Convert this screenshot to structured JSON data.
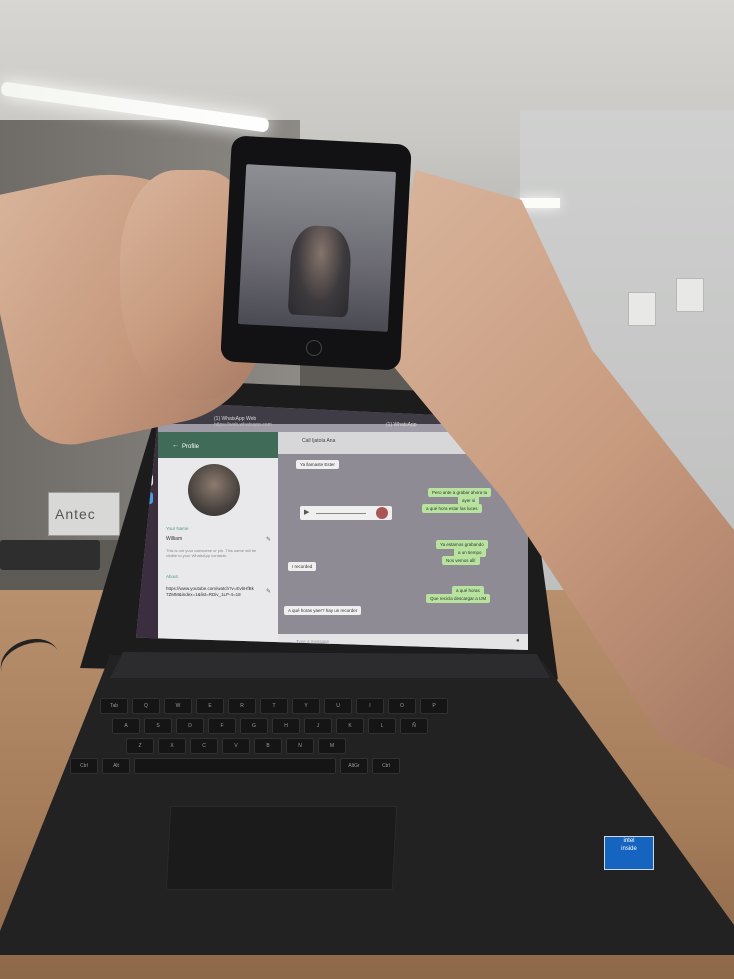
{
  "background": {
    "pc_brand": "Antec"
  },
  "browser": {
    "tab1": "(1) WhatsApp Web",
    "tab2": "(1) WhatsApp",
    "url": "https://web.whatsapp.com"
  },
  "profile": {
    "title": "Profile",
    "name_label": "Your Name",
    "name_value": "William",
    "hint": "This is not your username or pin. This name will be visible to your WhatsApp contacts.",
    "about_label": "About",
    "about_value": "https://www.youtube.com/watch?v=EvbHfBk7ZMM&index=1&list=RDiv_1LP-4=18"
  },
  "chat": {
    "name": "Call Ijatola Ana",
    "incoming": [
      "Ya llamaste Ester",
      "I recorded",
      "A qué horas yaer? hay un recorder"
    ],
    "outgoing": [
      "Pero ante a grabar ahora tu",
      "ayer si",
      "a qué hora estar las luces",
      "Ya estamos grabando",
      "a un tiempo",
      "Nos vemos allí",
      "a qué horas",
      "Que recicla descargar a IJM"
    ],
    "compose_placeholder": "Type a message"
  },
  "keyboard": {
    "row1": [
      "Tab",
      "Q",
      "W",
      "E",
      "R",
      "T",
      "Y",
      "U",
      "I",
      "O",
      "P"
    ],
    "row2": [
      "A",
      "S",
      "D",
      "F",
      "G",
      "H",
      "J",
      "K",
      "L",
      "Ñ"
    ],
    "row3": [
      "Z",
      "X",
      "C",
      "V",
      "B",
      "N",
      "M"
    ],
    "row4": [
      "Ctrl",
      "Alt",
      "AltGr",
      "Ctrl"
    ]
  },
  "sticker": {
    "brand": "intel",
    "line2": "inside"
  },
  "colors": {
    "whatsapp_header": "#3f6b58",
    "outgoing_bubble": "#b7e39f",
    "incoming_bubble": "#efeff0",
    "sticker_blue": "#1565c0"
  }
}
